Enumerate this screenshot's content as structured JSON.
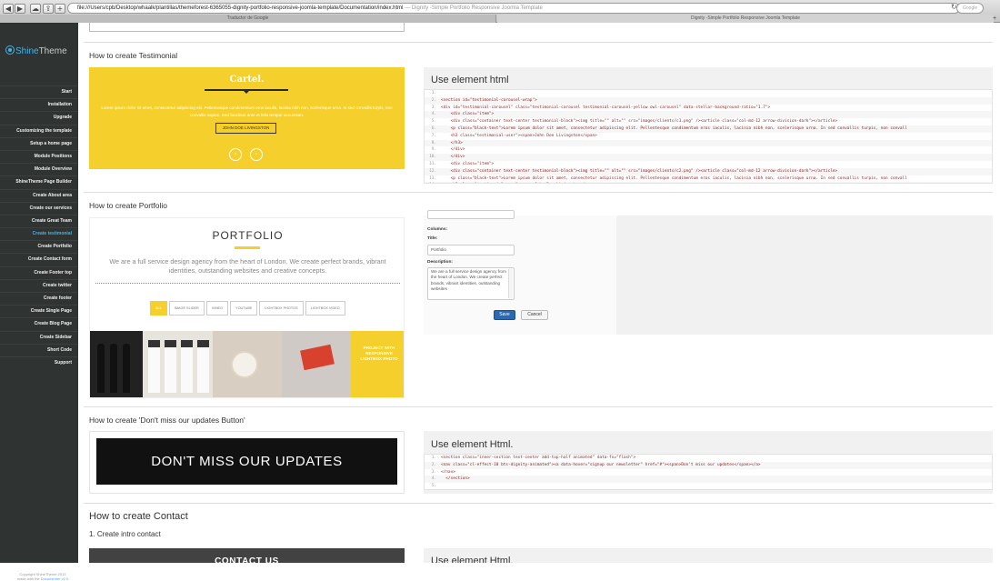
{
  "browser": {
    "url": "file:///Users/cpb/Desktop/whaalk/plantillas/themeforest-6365055-dignity-portfolio-responsive-joomla-template/Documentation/index.html",
    "url_title": "— Dignity -Simple Portfolio Responsive Joomla Template",
    "search_placeholder": "Google",
    "tabs": [
      "Traductor de Google",
      "Dignity -Simple Portfolio Responsive Joomla Template"
    ],
    "new_tab": "+",
    "buttons": {
      "back": "◀",
      "forward": "▶",
      "share": "⇪",
      "add": "+",
      "reload": "↻"
    }
  },
  "sidebar": {
    "logo_prefix": "S",
    "logo_mid": "hine",
    "logo_brand": "Theme",
    "menu": [
      "Start",
      "Installation",
      "Upgrade",
      "Customizing the template",
      "Setup a home page",
      "Module Positions",
      "Module Overview",
      "ShineTheme Page Builder",
      "Create About area",
      "Create our services",
      "Create Great Team",
      "Create testimonial",
      "Create Portfolio",
      "Create Contact form",
      "Create Footer top",
      "Create twitter",
      "Create footer",
      "Create Single Page",
      "Create Blog Page",
      "Create Sidebar",
      "Short Code",
      "Support"
    ],
    "active_index": 11,
    "copyright_line1": "Copyright ShineTheme 2013",
    "copyright_line2_prefix": "made with the ",
    "copyright_line2_link": "Documenter v2.0"
  },
  "testimonial": {
    "title": "How to create Testimonial",
    "brand": "Cartel.",
    "quote": "Lorem ipsum dolor sit amet, consectetur adipiscing elit. Pellentesque condimentum eros iaculis, lacinia nibh non, scelerisque urna. In sed convallis turpis, non convallis sapien. Sed faucibus ante et felis tempor accumsan.",
    "author": "JOHN DOE LIVINGSTON",
    "prev": "‹",
    "next": "›",
    "code_title": "Use element html",
    "code": [
      {
        "n": "1.",
        "t": ""
      },
      {
        "n": "2.",
        "t": "<section id=\"testimonial-carousel-wrap\">"
      },
      {
        "n": "3.",
        "t": "<div id=\"testimonial-carousel\" class=\"testimonial-carousel testimonial-carousel-yellow owl-carousel\" data-stellar-background-ratio=\"1.7\">"
      },
      {
        "n": "4.",
        "t": "    <div class=\"item\">"
      },
      {
        "n": "5.",
        "t": "    <div class=\"container text-center testimonial-block\"><img title=\"\" alt=\"\" src=\"images/clients/c1.png\" /><article class=\"col-md-12 arrow-division-dark\"></article>"
      },
      {
        "n": "6.",
        "t": "    <p class=\"black-text\">Lorem ipsum dolor sit amet, consectetur adipiscing elit. Pellentesque condimentum eros iaculis, lacinia nibh non, scelerisque urna. In sed convallis turpis, non convall"
      },
      {
        "n": "7.",
        "t": "    <h3 class=\"testimonial-user\"><span>John Doe Livingston</span>"
      },
      {
        "n": "8.",
        "t": "    </h3>"
      },
      {
        "n": "9.",
        "t": "    </div>"
      },
      {
        "n": "10.",
        "t": "    </div>"
      },
      {
        "n": "11.",
        "t": "    <div class=\"item\">"
      },
      {
        "n": "12.",
        "t": "    <div class=\"container text-center testimonial-block\"><img title=\"\" alt=\"\" src=\"images/clients/c2.png\" /><article class=\"col-md-12 arrow-division-dark\"></article>"
      },
      {
        "n": "13.",
        "t": "    <p class=\"black-text\">Lorem ipsum dolor sit amet, consectetur adipiscing elit. Pellentesque condimentum eros iaculis, lacinia nibh non, scelerisque urna. In sed convallis turpis, non convall"
      },
      {
        "n": "14.",
        "t": "    <h3 class=\"testimonial-user\"><span>John Doe Livingston</span>"
      }
    ]
  },
  "portfolio": {
    "title": "How to create Portfolio",
    "heading": "PORTFOLIO",
    "description": "We are a full service design agency from the heart of London. We create perfect brands, vibrant identities, outstanding websites and creative concepts.",
    "filters": [
      "ALL",
      "IMAGE SLIDER",
      "VIMEO",
      "YOUTUBE",
      "LIGHTBOX PHOTOS",
      "LIGHTBOX VIDEO"
    ],
    "tile_text": "PROJECT WITH RESPONSIVE LIGHTBOX PHOTO",
    "form": {
      "columns_label": "Columns:",
      "title_label": "Title:",
      "title_value": "Portfolio",
      "description_label": "Description:",
      "description_value": "We are a full service design agency from the heart of London. We create perfect brands, vibrant identities, outstanding websites",
      "save": "Save",
      "cancel": "Cancel"
    }
  },
  "updates": {
    "title": "How to create 'Don't miss our updates Button'",
    "banner": "DON'T MISS OUR UPDATES",
    "code_title": "Use element Html.",
    "code": [
      {
        "n": "1.",
        "t": "<section class=\"inner-section text-center add-top-half animated\" data-fx=\"flash\">"
      },
      {
        "n": "2.",
        "t": "<nav class=\"cl-effect-10 bts-dignity-animated\"><a data-hover=\"signup our newsletter\" href=\"#\"><span>Don't miss our updates</span></a>"
      },
      {
        "n": "3.",
        "t": "</nav>"
      },
      {
        "n": "4.",
        "t": "  </section>"
      },
      {
        "n": "5.",
        "t": ""
      }
    ]
  },
  "contact": {
    "title": "How to create Contact",
    "subtitle": "1. Create intro contact",
    "banner": "CONTACT US",
    "code_title": "Use element Html."
  },
  "colors": {
    "accent": "#45b2e8",
    "yellow": "#f5cf2b",
    "sidebar": "#2f3331"
  }
}
